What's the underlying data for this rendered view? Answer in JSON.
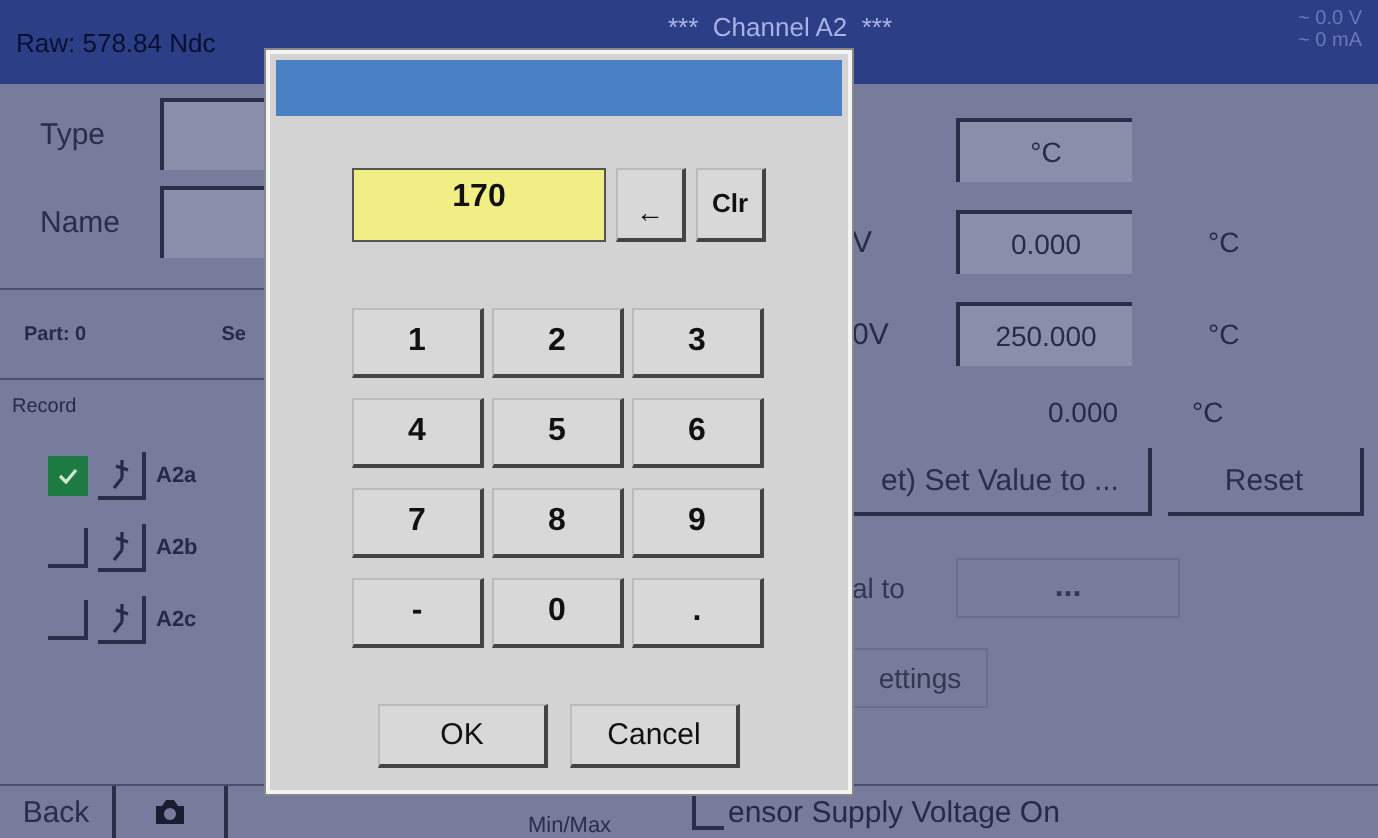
{
  "header": {
    "raw": "Raw: 578.84 Ndc",
    "title": "***  Channel A2  ***",
    "voltage": "~ 0.0 V",
    "current": "~ 0 mA"
  },
  "left": {
    "type_label": "Type",
    "name_label": "Name",
    "part": "Part:  0",
    "part_cut": "Se",
    "record_label": "Record",
    "channels": [
      {
        "label": "A2a",
        "checked": true
      },
      {
        "label": "A2b",
        "checked": false
      },
      {
        "label": "A2c",
        "checked": false
      }
    ]
  },
  "right": {
    "unit_field": "°C",
    "rows": [
      {
        "label": "V",
        "value": "0.000",
        "unit": "°C"
      },
      {
        "label": "0V",
        "value": "250.000",
        "unit": "°C"
      }
    ],
    "reading": {
      "value": "0.000",
      "unit": "°C"
    },
    "set_button": "et) Set Value to ...",
    "reset_button": "Reset",
    "disabled_label": "al to",
    "disabled_field": "...",
    "settings_button": "ettings"
  },
  "bottom": {
    "back": "Back",
    "minmax": "Min/Max",
    "sensor_supply": {
      "label": "ensor Supply Voltage On",
      "checked": false
    }
  },
  "dialog": {
    "display": "170",
    "backspace": "←",
    "clear": "Clr",
    "keys": [
      "1",
      "2",
      "3",
      "4",
      "5",
      "6",
      "7",
      "8",
      "9",
      "-",
      "0",
      "."
    ],
    "ok": "OK",
    "cancel": "Cancel"
  }
}
